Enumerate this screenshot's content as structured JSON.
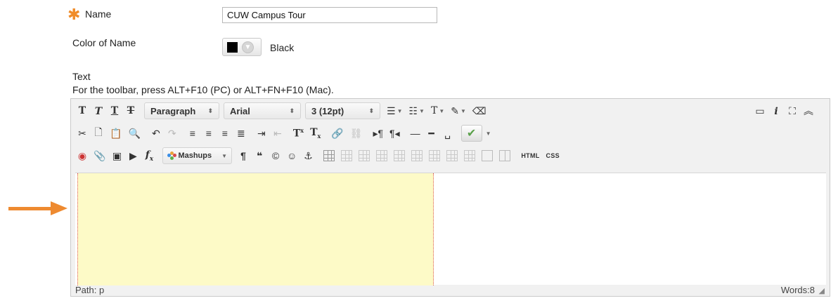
{
  "form": {
    "name_label": "Name",
    "name_value": "CUW Campus Tour",
    "color_label": "Color of Name",
    "color_value": "Black",
    "color_hex": "#000000",
    "text_label": "Text",
    "toolbar_hint": "For the toolbar, press ALT+F10 (PC) or ALT+FN+F10 (Mac)."
  },
  "toolbar": {
    "paragraph": "Paragraph",
    "font": "Arial",
    "size": "3 (12pt)",
    "mashups": "Mashups",
    "html": "HTML",
    "css": "CSS"
  },
  "status": {
    "path": "Path: p",
    "words": "Words:8"
  },
  "colors": {
    "accent": "#ee8a30",
    "highlight": "#fdfac7"
  }
}
